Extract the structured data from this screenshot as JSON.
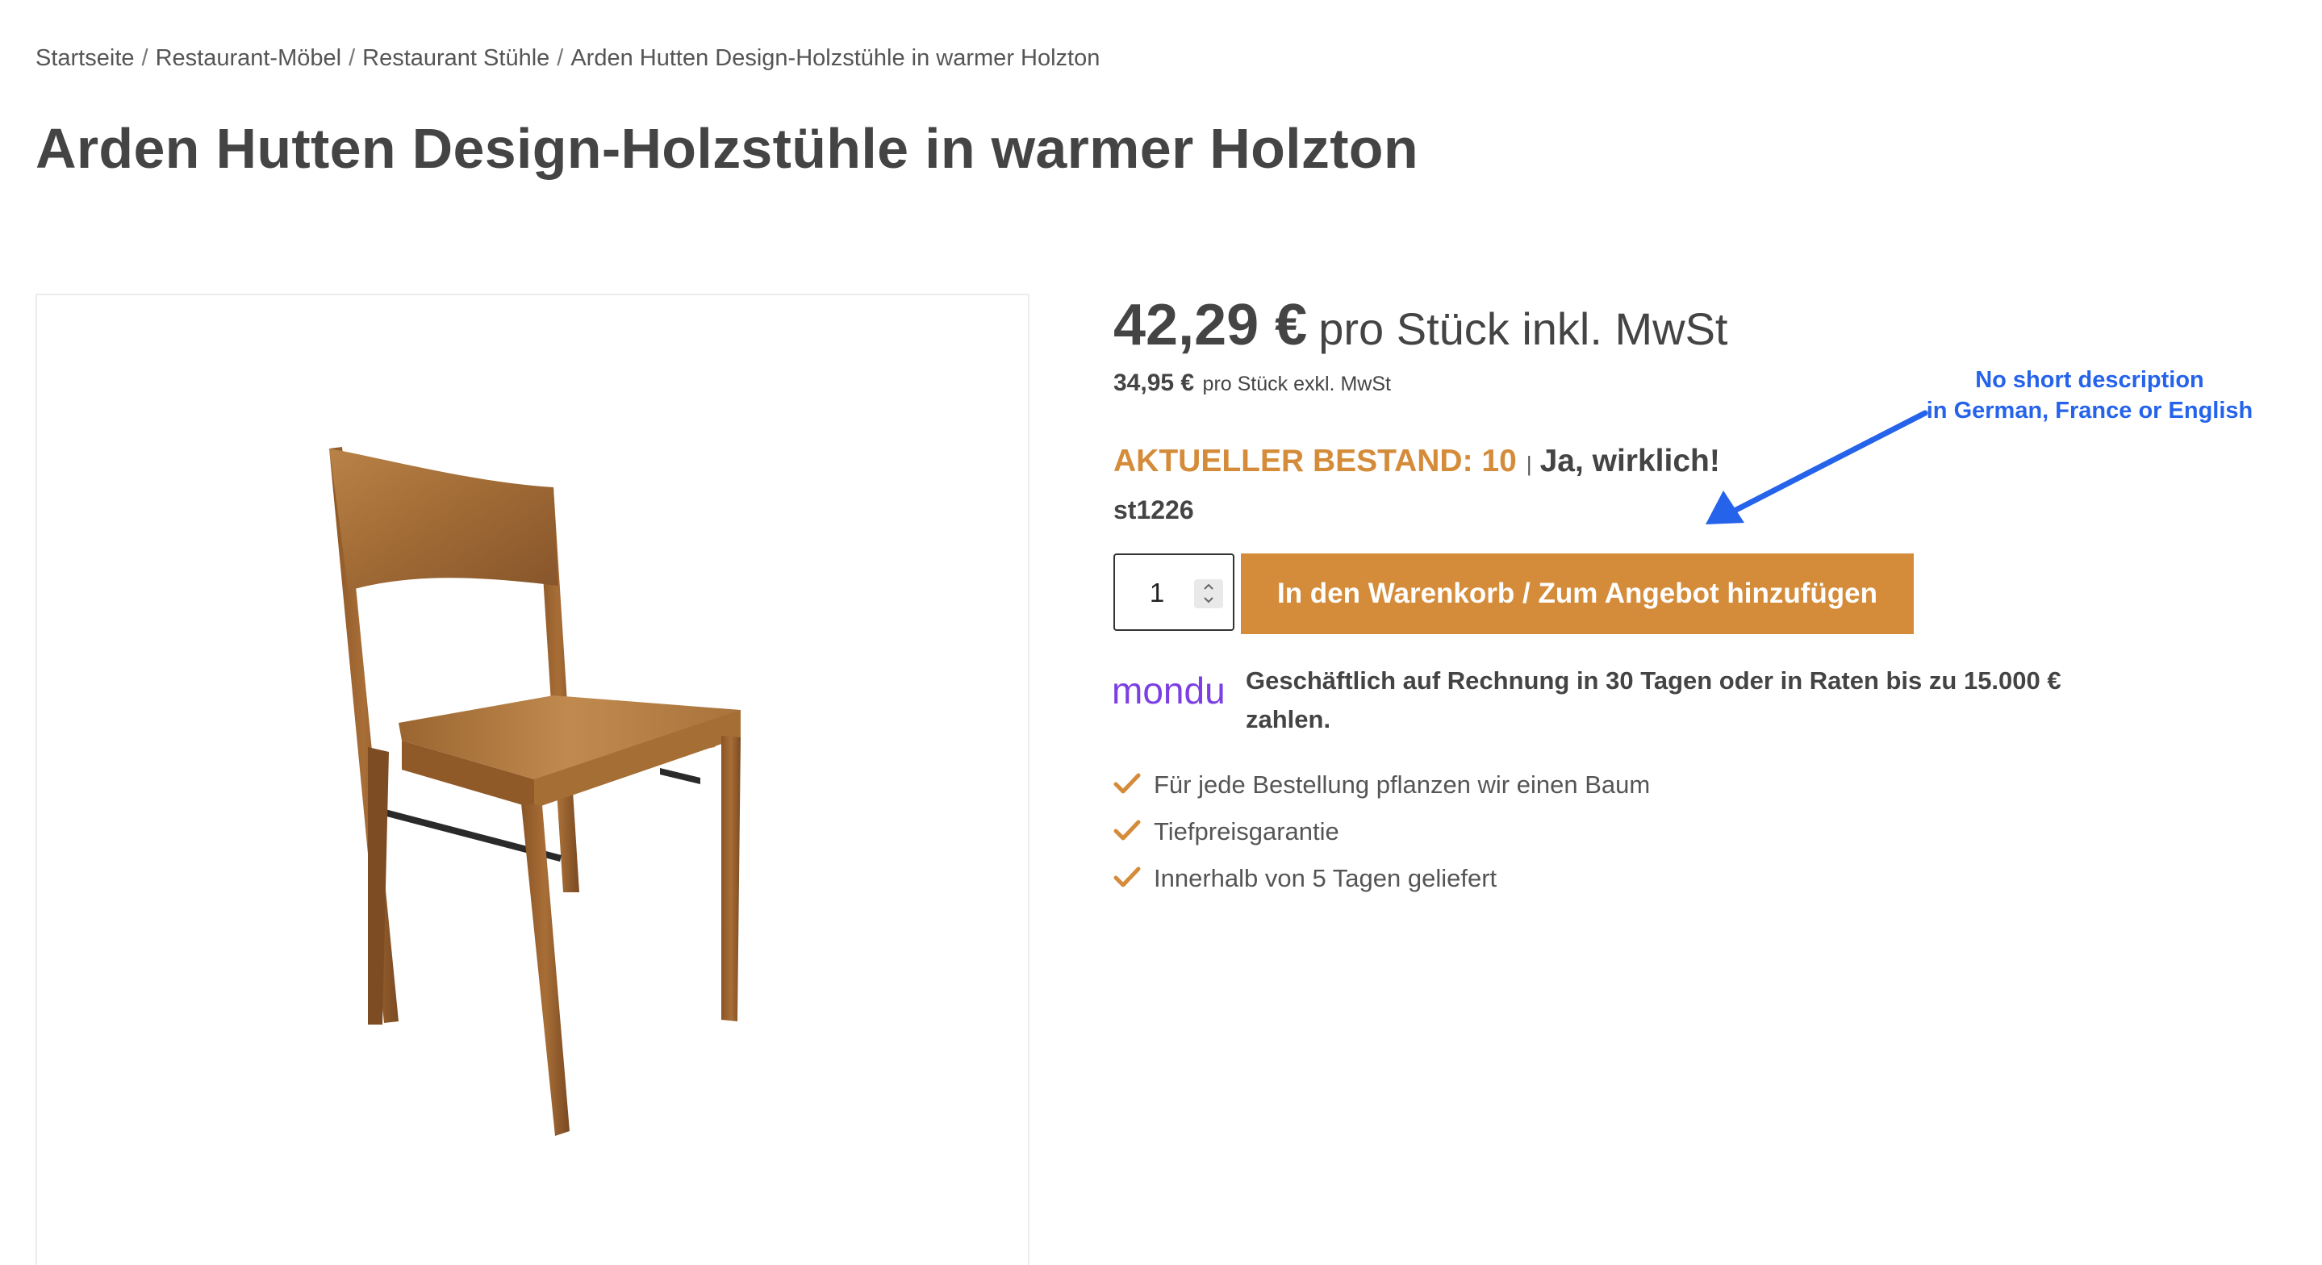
{
  "breadcrumb": {
    "items": [
      "Startseite",
      "Restaurant-Möbel",
      "Restaurant Stühle",
      "Arden Hutten Design-Holzstühle in warmer Holzton"
    ],
    "separator": "/"
  },
  "product": {
    "title": "Arden Hutten Design-Holzstühle in warmer Holzton",
    "price_gross": "42,29 €",
    "price_gross_unit": "pro Stück inkl. MwSt",
    "price_net": "34,95 €",
    "price_net_unit": "pro Stück exkl. MwSt",
    "stock_label": "AKTUELLER BESTAND: 10",
    "stock_separator": "|",
    "stock_note": "Ja, wirklich!",
    "sku": "st1226",
    "quantity": "1",
    "add_to_cart_label": "In den Warenkorb / Zum Angebot hinzufügen"
  },
  "payment": {
    "provider_logo": "mondu",
    "text": "Geschäftlich auf Rechnung in 30 Tagen oder in Raten bis zu 15.000 € zahlen."
  },
  "usps": [
    "Für jede Bestellung pflanzen wir einen Baum",
    "Tiefpreisgarantie",
    "Innerhalb von 5 Tagen geliefert"
  ],
  "annotation": {
    "line1": "No short description",
    "line2": "in German, France or English"
  },
  "colors": {
    "accent": "#d48c3a",
    "text": "#444444",
    "annotation": "#2563eb",
    "mondu": "#7b3fe4"
  },
  "icons": {
    "usp": "check-icon",
    "quantity": "spinner-arrows-icon",
    "annotation": "arrow-icon"
  }
}
